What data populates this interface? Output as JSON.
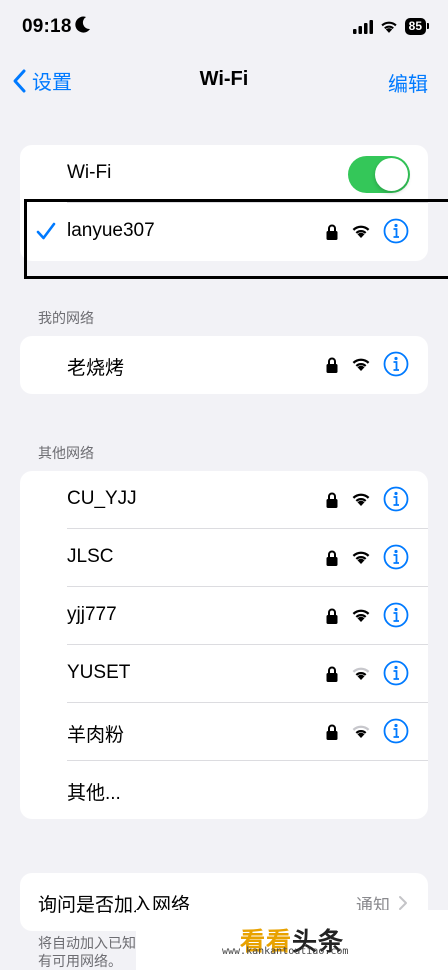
{
  "status_bar": {
    "time": "09:18",
    "battery": "85"
  },
  "nav": {
    "back_label": "设置",
    "title": "Wi-Fi",
    "edit_label": "编辑"
  },
  "wifi_toggle": {
    "label": "Wi-Fi",
    "on": true
  },
  "connected": {
    "name": "lanyue307"
  },
  "my_networks": {
    "header": "我的网络",
    "items": [
      {
        "name": "老烧烤"
      }
    ]
  },
  "other_networks": {
    "header": "其他网络",
    "items": [
      {
        "name": "CU_YJJ",
        "signal": "strong"
      },
      {
        "name": "JLSC",
        "signal": "strong"
      },
      {
        "name": "yjj777",
        "signal": "strong"
      },
      {
        "name": "YUSET",
        "signal": "weak"
      },
      {
        "name": "羊肉粉",
        "signal": "weak"
      }
    ],
    "other_label": "其他..."
  },
  "ask_join": {
    "label": "询问是否加入网络",
    "value": "通知"
  },
  "footer": {
    "line1": "将自动加入已知网络。如果没有已知网络，将通知您",
    "line2": "有可用网络。"
  },
  "watermark": {
    "main": "看看",
    "main2": "头条",
    "sub": "www.kankantoutiao.com"
  },
  "colors": {
    "accent": "#007aff",
    "toggle_on": "#34c759",
    "background": "#f2f2f6"
  },
  "icons": [
    "moon-icon",
    "cellular-icon",
    "wifi-icon",
    "battery-icon",
    "back-chevron-icon",
    "checkmark-icon",
    "lock-icon",
    "info-icon"
  ]
}
